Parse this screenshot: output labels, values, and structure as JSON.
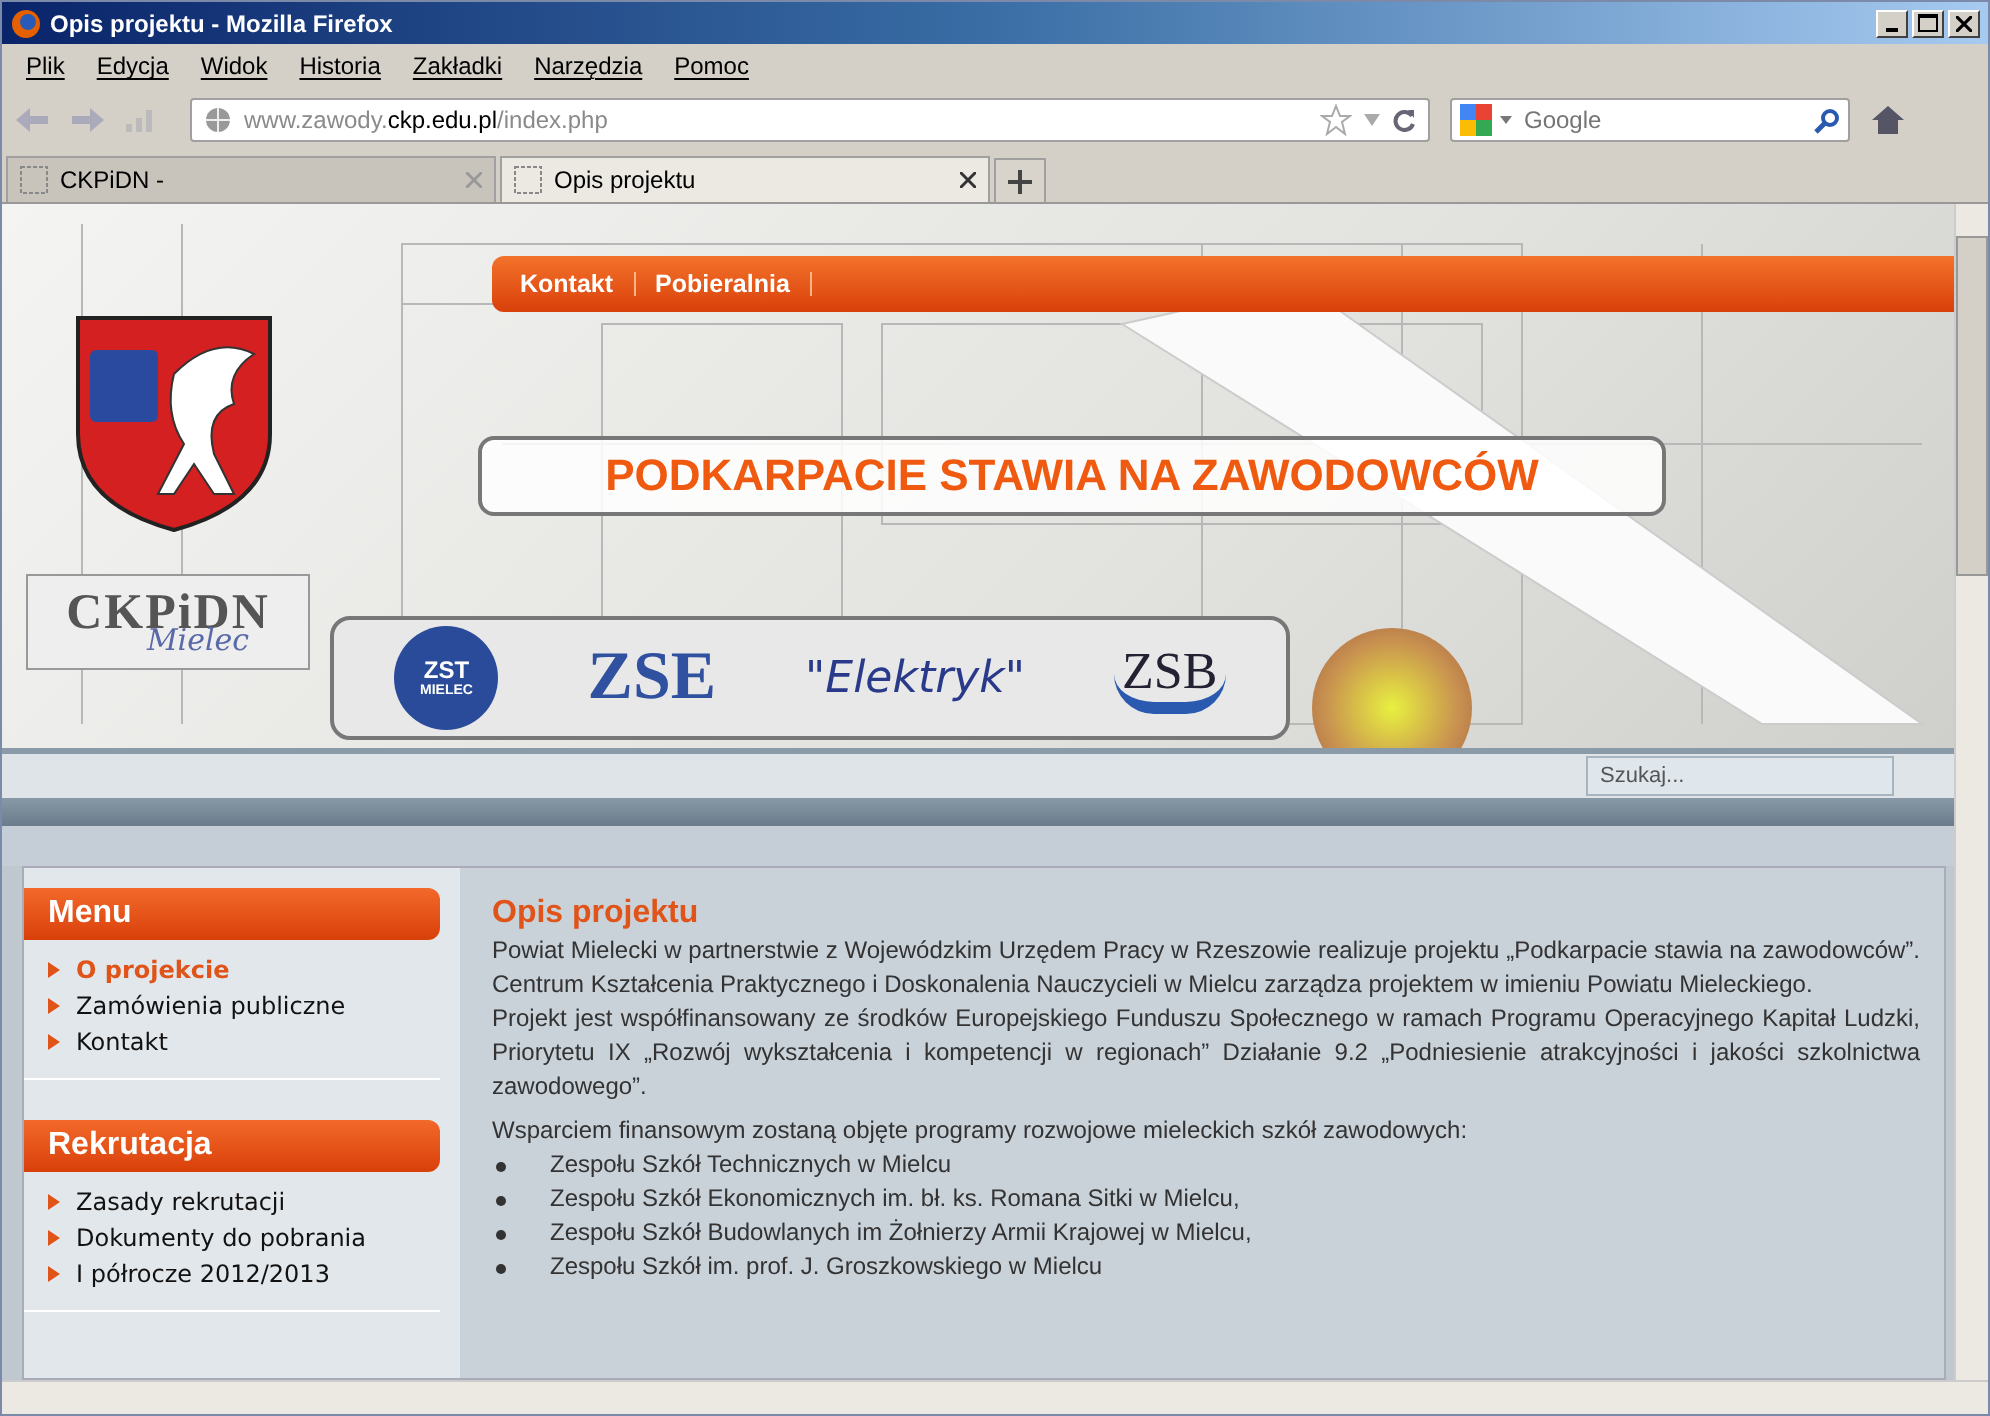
{
  "window": {
    "title": "Opis projektu - Mozilla Firefox"
  },
  "menu_bar": [
    "Plik",
    "Edycja",
    "Widok",
    "Historia",
    "Zakładki",
    "Narzędzia",
    "Pomoc"
  ],
  "address_bar": {
    "prefix": "www.zawody.",
    "domain": "ckp.edu.pl",
    "path": "/index.php"
  },
  "search_bar": {
    "placeholder": "Google"
  },
  "tabs": [
    {
      "label": "CKPiDN -",
      "selected": false
    },
    {
      "label": "Opis projektu",
      "selected": true
    }
  ],
  "page": {
    "top_nav": [
      "Kontakt",
      "Pobieralnia"
    ],
    "banner_title": "PODKARPACIE STAWIA NA ZAWODOWCÓW",
    "ckpidn_logo": {
      "name": "CKPiDN",
      "city": "Mielec"
    },
    "school_logos": [
      {
        "kind": "zst",
        "text": "ZST",
        "sub": "MIELEC"
      },
      {
        "kind": "zse",
        "text": "ZSE"
      },
      {
        "kind": "elektryk",
        "text": "\"Elektryk\""
      },
      {
        "kind": "zsb",
        "text": "ZSB"
      }
    ],
    "site_search": {
      "placeholder": "Szukaj..."
    },
    "sidebar": [
      {
        "title": "Menu",
        "items": [
          {
            "label": "O projekcie",
            "selected": true
          },
          {
            "label": "Zamówienia publiczne",
            "selected": false
          },
          {
            "label": "Kontakt",
            "selected": false
          }
        ]
      },
      {
        "title": "Rekrutacja",
        "items": [
          {
            "label": "Zasady rekrutacji",
            "selected": false
          },
          {
            "label": "Dokumenty do pobrania",
            "selected": false
          },
          {
            "label": "I półrocze 2012/2013",
            "selected": false
          }
        ]
      }
    ],
    "article": {
      "title": "Opis projektu",
      "paragraphs": [
        "Powiat Mielecki w partnerstwie z Wojewódzkim Urzędem Pracy w Rzeszowie realizuje projektu „Podkarpacie stawia na zawodowców”. Centrum Kształcenia Praktycznego i Doskonalenia Nauczycieli w Mielcu zarządza projektem w imieniu Powiatu Mieleckiego.",
        "Projekt jest współfinansowany ze środków Europejskiego Funduszu Społecznego w ramach Programu Operacyjnego Kapitał Ludzki, Priorytetu IX „Rozwój wykształcenia i kompetencji w regionach” Działanie 9.2 „Podniesienie atrakcyjności i jakości szkolnictwa zawodowego”.",
        "Wsparciem finansowym zostaną objęte programy rozwojowe mieleckich szkół zawodowych:"
      ],
      "list": [
        "Zespołu Szkół Technicznych w Mielcu",
        "Zespołu Szkół Ekonomicznych im. bł. ks. Romana Sitki w Mielcu,",
        "Zespołu Szkół Budowlanych im Żołnierzy Armii Krajowej w Mielcu,",
        "Zespołu Szkół im. prof. J. Groszkowskiego w Mielcu"
      ]
    }
  }
}
